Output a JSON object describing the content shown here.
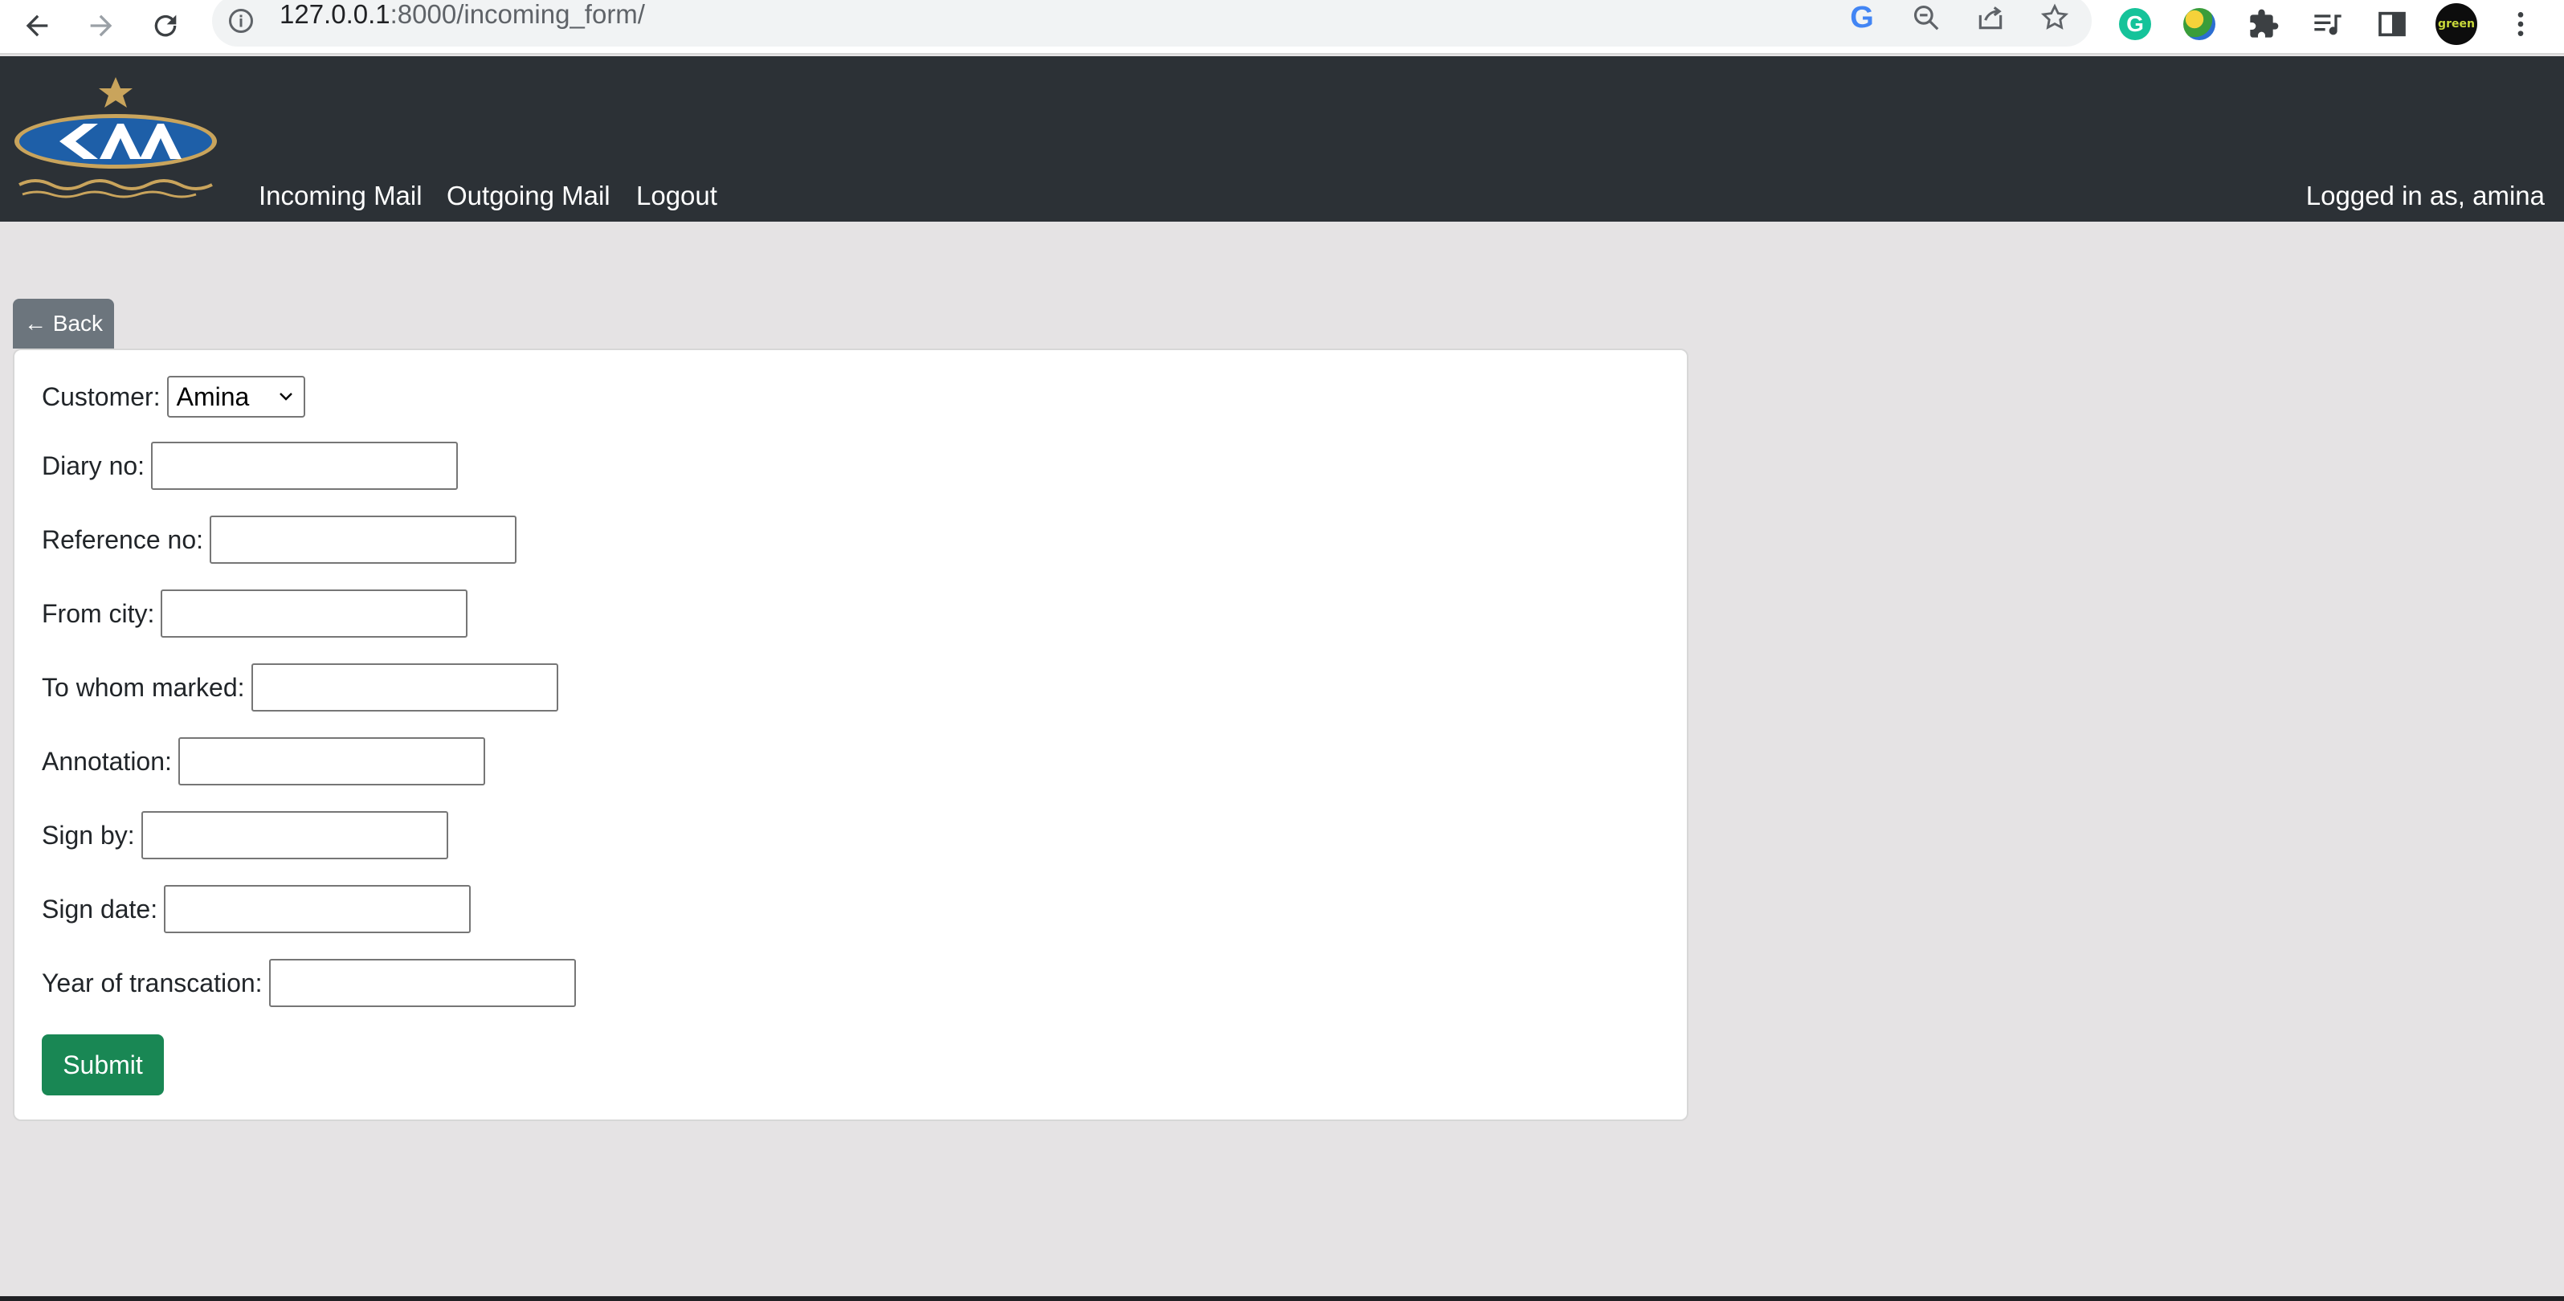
{
  "browser": {
    "url_host": "127.0.0.1",
    "url_path": ":8000/incoming_form/",
    "icons": [
      "back-arrow-icon",
      "forward-arrow-icon",
      "reload-icon",
      "info-icon",
      "google-icon",
      "zoom-out-icon",
      "share-icon",
      "bookmark-star-icon",
      "grammarly-icon",
      "globe-extension-icon",
      "extensions-puzzle-icon",
      "media-queue-icon",
      "side-panel-icon",
      "profile-avatar",
      "kebab-menu-icon"
    ],
    "avatar_text": "green"
  },
  "navbar": {
    "logo_alt": "CAA",
    "links": [
      {
        "label": "Incoming Mail"
      },
      {
        "label": "Outgoing Mail"
      },
      {
        "label": "Logout"
      }
    ],
    "user_text": "Logged in as, amina",
    "background": "#2c3136"
  },
  "back_button": {
    "label": "← Back",
    "color": "#6c757d"
  },
  "form": {
    "customer": {
      "label": "Customer:",
      "selected": "Amina"
    },
    "fields": [
      {
        "label": "Diary no:",
        "value": ""
      },
      {
        "label": "Reference no:",
        "value": ""
      },
      {
        "label": "From city:",
        "value": ""
      },
      {
        "label": "To whom marked:",
        "value": ""
      },
      {
        "label": "Annotation:",
        "value": ""
      },
      {
        "label": "Sign by:",
        "value": ""
      },
      {
        "label": "Sign date:",
        "value": ""
      },
      {
        "label": "Year of transcation:",
        "value": ""
      }
    ],
    "submit_label": "Submit",
    "submit_color": "#198754"
  }
}
